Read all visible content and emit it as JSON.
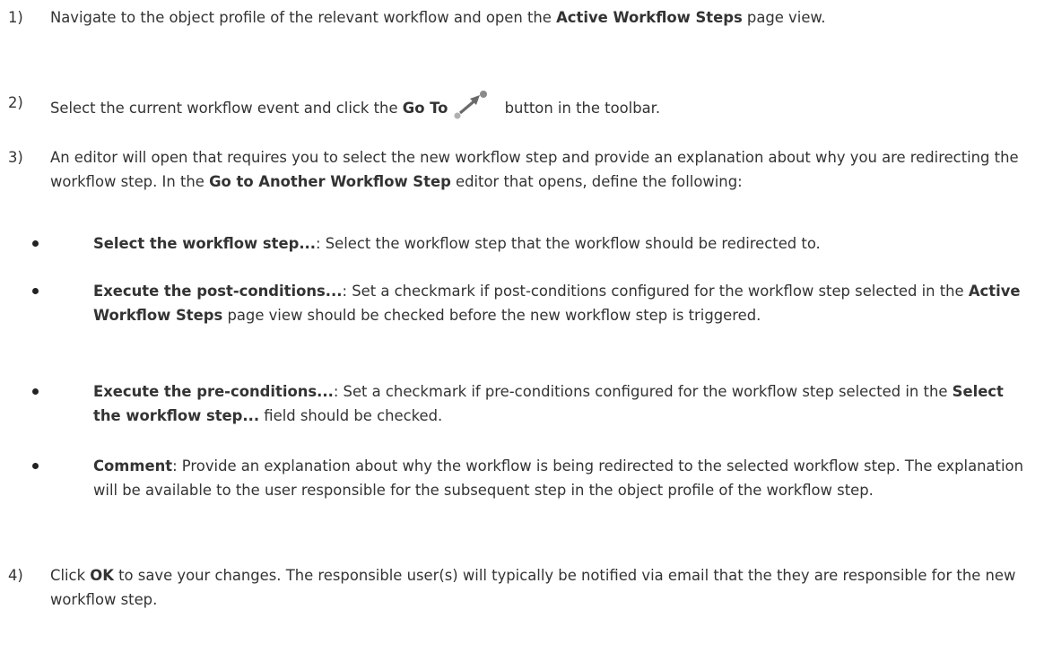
{
  "steps": [
    {
      "number": "1)",
      "t1": "Navigate to the object profile of the relevant workflow and open the ",
      "b1": "Active Workflow Steps",
      "t2": " page view."
    },
    {
      "number": "2)",
      "t1": "Select the current workflow event and click the ",
      "b1": "Go To",
      "t2": " button in the toolbar."
    },
    {
      "number": "3)",
      "t1": "An editor will open that requires you to select the new workflow step and provide an explanation about why you are redirecting the workflow step. In the ",
      "b1": "Go to Another Workflow Step",
      "t2": " editor that opens, define the following:"
    },
    {
      "number": "4)",
      "t1": "Click ",
      "b1": "OK",
      "t2": " to save your changes. The responsible user(s) will typically be notified via email that the they are responsible for the new workflow step."
    }
  ],
  "bullets": [
    {
      "b1": "Select the workflow step...",
      "t1": ": Select the workflow step that the workflow should be redirected to."
    },
    {
      "b1": "Execute the post-conditions...",
      "t1": ": Set a checkmark if post-conditions configured for the workflow step selected in the ",
      "b2": "Active Workflow Steps",
      "t2": " page view should be checked before the new workflow step is triggered."
    },
    {
      "b1": "Execute the pre-conditions...",
      "t1": ": Set a checkmark if pre-conditions configured for the workflow step selected in the ",
      "b2": "Select the workflow step...",
      "t2": " field should be checked."
    },
    {
      "b1": "Comment",
      "t1": ": Provide an explanation about why the workflow is being redirected to the selected workflow step. The explanation will be available to the user responsible for the subsequent step in the object profile of the workflow step."
    }
  ],
  "icons": {
    "go_to": "go-to-arrow-icon"
  }
}
